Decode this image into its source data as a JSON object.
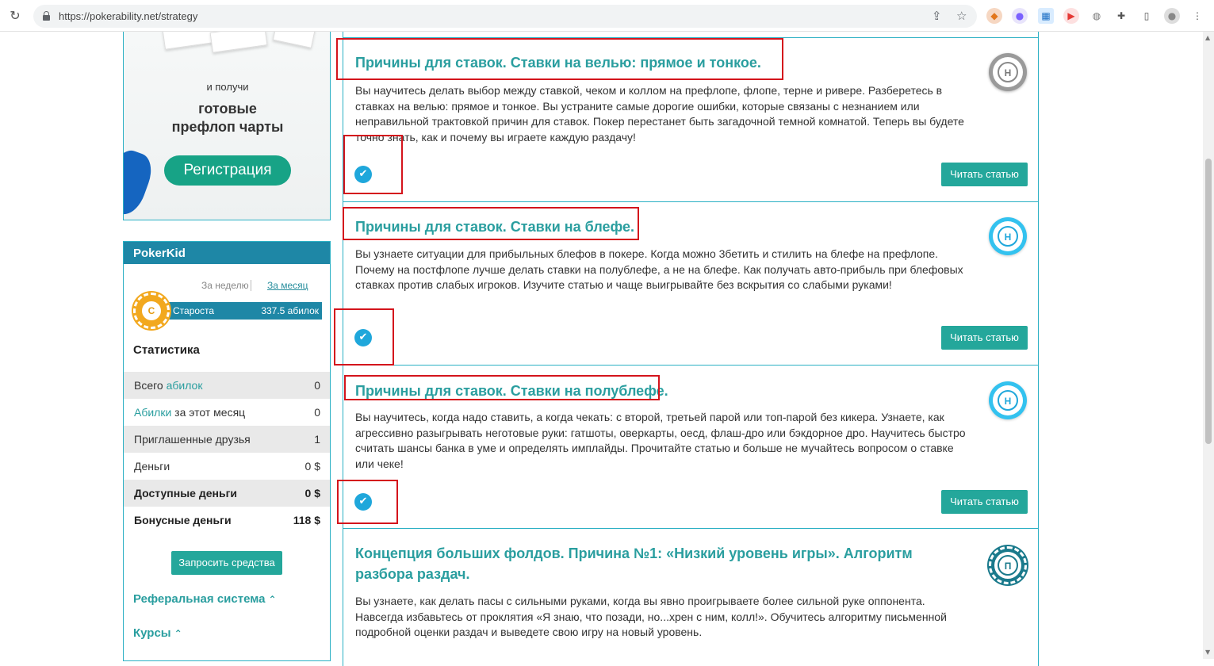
{
  "browser": {
    "url": "https://pokerability.net/strategy"
  },
  "banner": {
    "small_text": "и получи",
    "big_line1": "готовые",
    "big_line2": "префлоп чарты",
    "register_label": "Регистрация"
  },
  "sidebar": {
    "username": "PokerKid",
    "period_week": "За неделю",
    "period_month": "За месяц",
    "rank_letter": "С",
    "rank_name": "Староста",
    "rank_value": "337.5 абилок",
    "stats_title": "Статистика",
    "stats": [
      {
        "label_pre": "Всего ",
        "label_link": "абилок",
        "label_post": "",
        "value": "0"
      },
      {
        "label_pre": "",
        "label_link": "Абилки",
        "label_post": " за этот месяц",
        "value": "0"
      },
      {
        "label_pre": "Приглашенные друзья",
        "label_link": "",
        "label_post": "",
        "value": "1"
      },
      {
        "label_pre": "Деньги",
        "label_link": "",
        "label_post": "",
        "value": "0 $"
      },
      {
        "label_pre": "Доступные деньги",
        "label_link": "",
        "label_post": "",
        "value": "0 $"
      },
      {
        "label_pre": "Бонусные деньги",
        "label_link": "",
        "label_post": "",
        "value": "118 $"
      }
    ],
    "request_label": "Запросить средства",
    "referral_label": "Реферальная система",
    "courses_label": "Курсы"
  },
  "articles": [
    {
      "title": "Причины для ставок. Ставки на велью: прямое и тонкое.",
      "text": "Вы научитесь делать выбор между ставкой, чеком и коллом на префлопе, флопе, терне и ривере. Разберетесь в ставках на велью: прямое и тонкое. Вы устраните самые дорогие ошибки, которые связаны с незнанием или неправильной трактовкой причин для ставок. Покер перестанет быть загадочной темной комнатой. Теперь вы будете точно знать, как и почему вы играете каждую раздачу!",
      "level": "Н",
      "read_label": "Читать статью"
    },
    {
      "title": "Причины для ставок. Ставки на блефе.",
      "text": "Вы узнаете ситуации для прибыльных блефов в покере. Когда можно 3бетить и стилить на блефе на префлопе. Почему на постфлопе лучше делать ставки на полублефе, а не на блефе. Как получать авто-прибыль при блефовых ставках против слабых игроков. Изучите статью и чаще выигрывайте без вскрытия со слабыми руками!",
      "level": "Н",
      "read_label": "Читать статью"
    },
    {
      "title": "Причины для ставок. Ставки на полублефе.",
      "text": "Вы научитесь, когда надо ставить, а когда чекать: с второй, третьей парой или топ-парой без кикера. Узнаете, как агрессивно разыгрывать неготовые руки: гатшоты, оверкарты, оесд, флаш-дро или бэкдорное дро. Научитесь быстро считать шансы банка в уме и определять имплайды. Прочитайте статью и больше не мучайтесь вопросом о ставке или чеке!",
      "level": "Н",
      "read_label": "Читать статью"
    },
    {
      "title": "Концепция больших фолдов. Причина №1: «Низкий уровень игры». Алгоритм разбора раздач.",
      "text": "Вы узнаете, как делать пасы с сильными руками, когда вы явно проигрываете более сильной руке оппонента. Навсегда избавьтесь от проклятия «Я знаю, что позади, но...хрен с ним, колл!». Обучитесь алгоритму письменной подробной оценки раздач и выведете свою игру на новый уровень.",
      "level": "П"
    }
  ],
  "icons": {
    "check": "✔",
    "chevron_up": "⌃"
  }
}
